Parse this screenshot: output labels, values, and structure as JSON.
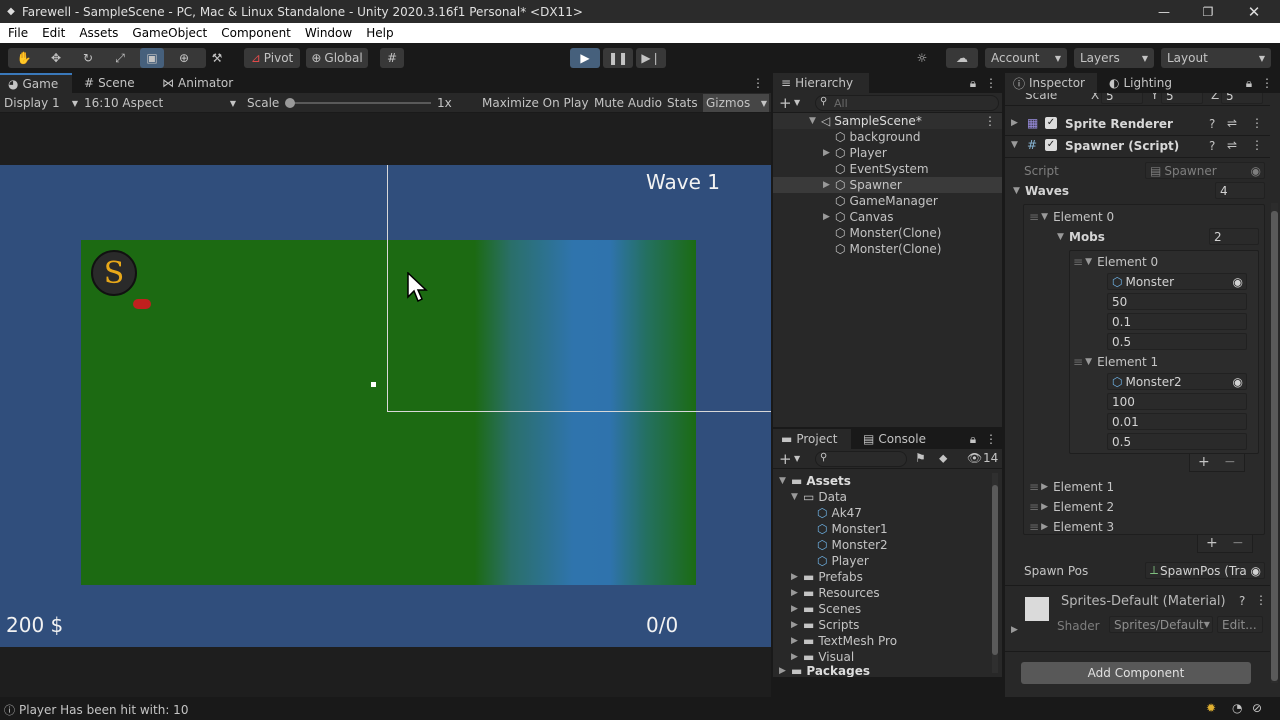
{
  "window": {
    "title": "Farewell - SampleScene - PC, Mac & Linux Standalone - Unity 2020.3.16f1 Personal* <DX11>"
  },
  "menu": [
    "File",
    "Edit",
    "Assets",
    "GameObject",
    "Component",
    "Window",
    "Help"
  ],
  "toolbar": {
    "pivot": "Pivot",
    "global": "Global",
    "account": "Account",
    "layers": "Layers",
    "layout": "Layout"
  },
  "game": {
    "tabs": [
      "Game",
      "Scene",
      "Animator"
    ],
    "display": "Display 1",
    "aspect": "16:10 Aspect",
    "scale_label": "Scale",
    "scale_value": "1x",
    "maximize": "Maximize On Play",
    "mute": "Mute Audio",
    "stats": "Stats",
    "gizmos": "Gizmos",
    "wave": "Wave 1",
    "money": "200 $",
    "count": "0/0"
  },
  "hierarchy": {
    "title": "Hierarchy",
    "search_placeholder": "All",
    "scene": "SampleScene*",
    "items": [
      "background",
      "Player",
      "EventSystem",
      "Spawner",
      "GameManager",
      "Canvas",
      "Monster(Clone)",
      "Monster(Clone)"
    ]
  },
  "project": {
    "tabs": [
      "Project",
      "Console"
    ],
    "count": "14",
    "assets": "Assets",
    "data": "Data",
    "data_items": [
      "Ak47",
      "Monster1",
      "Monster2",
      "Player"
    ],
    "folders": [
      "Prefabs",
      "Resources",
      "Scenes",
      "Scripts",
      "TextMesh Pro",
      "Visual"
    ],
    "packages": "Packages"
  },
  "inspector": {
    "tabs": [
      "Inspector",
      "Lighting"
    ],
    "scale": {
      "label": "Scale",
      "x": "5",
      "y": "5",
      "z": "5"
    },
    "sprite_renderer": "Sprite Renderer",
    "spawner": "Spawner (Script)",
    "script_label": "Script",
    "script_value": "Spawner",
    "waves_label": "Waves",
    "waves_count": "4",
    "element0": "Element 0",
    "mobs_label": "Mobs",
    "mobs_count": "2",
    "mob0": {
      "label": "Element 0",
      "ref": "Monster",
      "v1": "50",
      "v2": "0.1",
      "v3": "0.5"
    },
    "mob1": {
      "label": "Element 1",
      "ref": "Monster2",
      "v1": "100",
      "v2": "0.01",
      "v3": "0.5"
    },
    "other_elements": [
      "Element 1",
      "Element 2",
      "Element 3"
    ],
    "spawn_pos_label": "Spawn Pos",
    "spawn_pos_value": "SpawnPos (Tra",
    "material": "Sprites-Default (Material)",
    "shader_label": "Shader",
    "shader_value": "Sprites/Default",
    "edit": "Edit...",
    "add_component": "Add Component"
  },
  "status": {
    "message": "Player Has been hit with: 10"
  }
}
